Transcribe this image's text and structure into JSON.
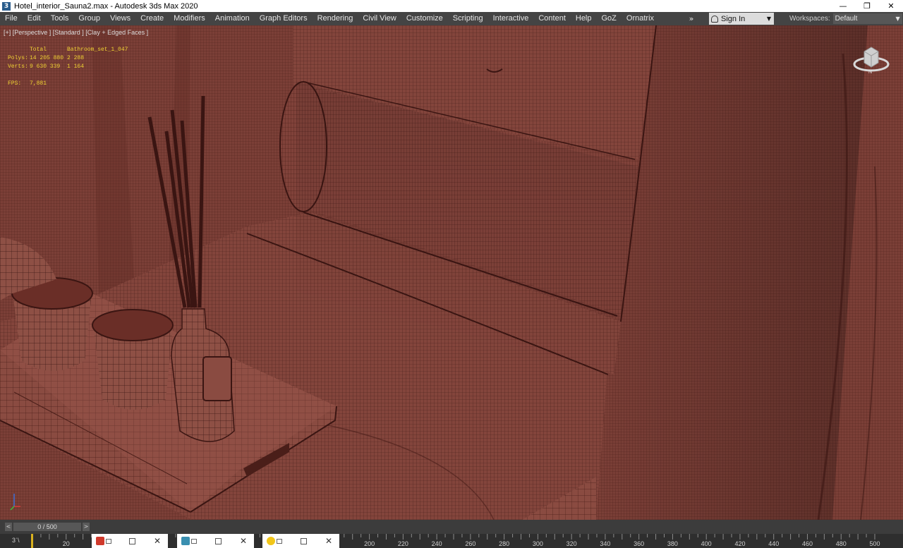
{
  "window": {
    "title": "Hotel_interior_Sauna2.max - Autodesk 3ds Max 2020",
    "app_icon_text": "3",
    "controls": {
      "minimize": "—",
      "restore": "❐",
      "close": "✕"
    }
  },
  "menu": {
    "items": [
      "File",
      "Edit",
      "Tools",
      "Group",
      "Views",
      "Create",
      "Modifiers",
      "Animation",
      "Graph Editors",
      "Rendering",
      "Civil View",
      "Customize",
      "Scripting",
      "Interactive",
      "Content",
      "Help",
      "GoZ",
      "Ornatrix"
    ],
    "overflow": "»",
    "sign_in": "Sign In",
    "workspaces_label": "Workspaces:",
    "workspaces_value": "Default"
  },
  "viewport": {
    "label": "[+] [Perspective ] [Standard ] [Clay + Edged Faces ]",
    "stats": {
      "header_total": "Total",
      "header_object": "Bathroom_set_1_047",
      "polys_label": "Polys:",
      "polys_total": "14 205 880",
      "polys_object": "2 288",
      "verts_label": "Verts:",
      "verts_total": "9 630 339",
      "verts_object": "1 164",
      "fps_label": "FPS:",
      "fps_value": "7,881"
    },
    "viewcube_label": "N",
    "mesh_color": "#7a3d35"
  },
  "timeslider": {
    "prev": "<",
    "value": "0 / 500",
    "next": ">"
  },
  "trackbar": {
    "start_label": "3ˈ\\",
    "ticks": [
      "20",
      "200",
      "220",
      "240",
      "260",
      "280",
      "300",
      "320",
      "340",
      "360",
      "380",
      "400",
      "420",
      "440",
      "460",
      "480",
      "500"
    ]
  },
  "taskbar": {
    "close_glyph": "✕"
  }
}
